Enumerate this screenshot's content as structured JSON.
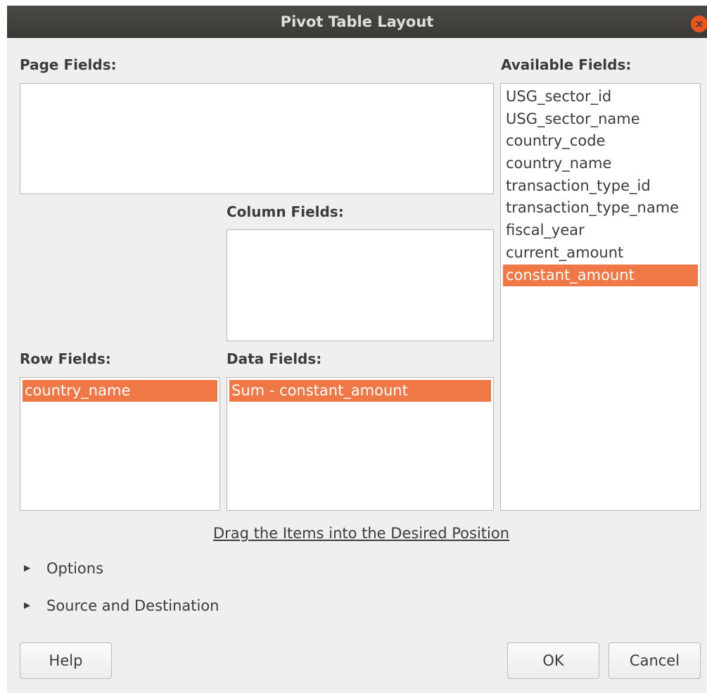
{
  "window": {
    "title": "Pivot Table Layout",
    "close_icon": "×"
  },
  "labels": {
    "page_fields": "Page Fields:",
    "available_fields": "Available Fields:",
    "column_fields": "Column Fields:",
    "row_fields": "Row Fields:",
    "data_fields": "Data Fields:"
  },
  "available_fields": [
    "USG_sector_id",
    "USG_sector_name",
    "country_code",
    "country_name",
    "transaction_type_id",
    "transaction_type_name",
    "fiscal_year",
    "current_amount",
    "constant_amount"
  ],
  "available_selected_index": 8,
  "row_fields": [
    "country_name"
  ],
  "data_fields": [
    "Sum - constant_amount"
  ],
  "hint": "Drag the Items into the Desired Position",
  "expanders": {
    "options": "Options",
    "source_destination": "Source and Destination",
    "arrow_icon": "▶"
  },
  "buttons": {
    "help": "Help",
    "ok": "OK",
    "cancel": "Cancel"
  },
  "colors": {
    "selection": "#f07746",
    "titlebar": "#3c3b37",
    "close": "#e95420"
  }
}
